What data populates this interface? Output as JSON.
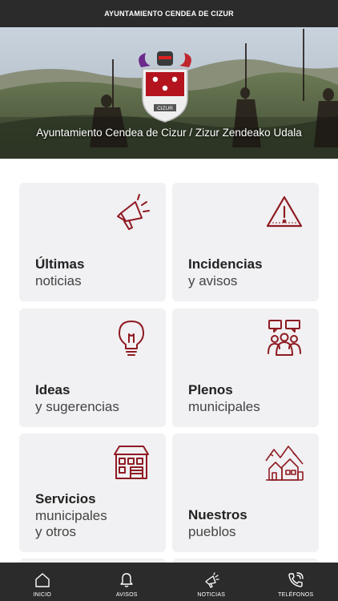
{
  "header": {
    "title": "AYUNTAMIENTO CENDEA DE CIZUR"
  },
  "hero": {
    "caption": "Ayuntamiento Cendea de Cizur / Zizur Zendeako Udala",
    "crest_label": "CIZUR"
  },
  "cards": [
    {
      "title": "Últimas",
      "subtitle": "noticias",
      "icon": "megaphone-icon"
    },
    {
      "title": "Incidencias",
      "subtitle": "y avisos",
      "icon": "warning-icon"
    },
    {
      "title": "Ideas",
      "subtitle": "y sugerencias",
      "icon": "lightbulb-icon"
    },
    {
      "title": "Plenos",
      "subtitle": "municipales",
      "icon": "meeting-icon"
    },
    {
      "title": "Servicios",
      "subtitle": "municipales",
      "subtitle2": "y otros",
      "icon": "building-icon"
    },
    {
      "title": "Nuestros",
      "subtitle": "pueblos",
      "icon": "village-icon"
    }
  ],
  "nav": [
    {
      "label": "INICIO",
      "icon": "home-icon"
    },
    {
      "label": "AVISOS",
      "icon": "bell-icon"
    },
    {
      "label": "NOTICIAS",
      "icon": "megaphone-icon"
    },
    {
      "label": "TELÉFONOS",
      "icon": "phone-icon"
    }
  ],
  "colors": {
    "accent": "#8e1b22",
    "bars": "#2b2b2b",
    "card_bg": "#f1f0f2"
  }
}
